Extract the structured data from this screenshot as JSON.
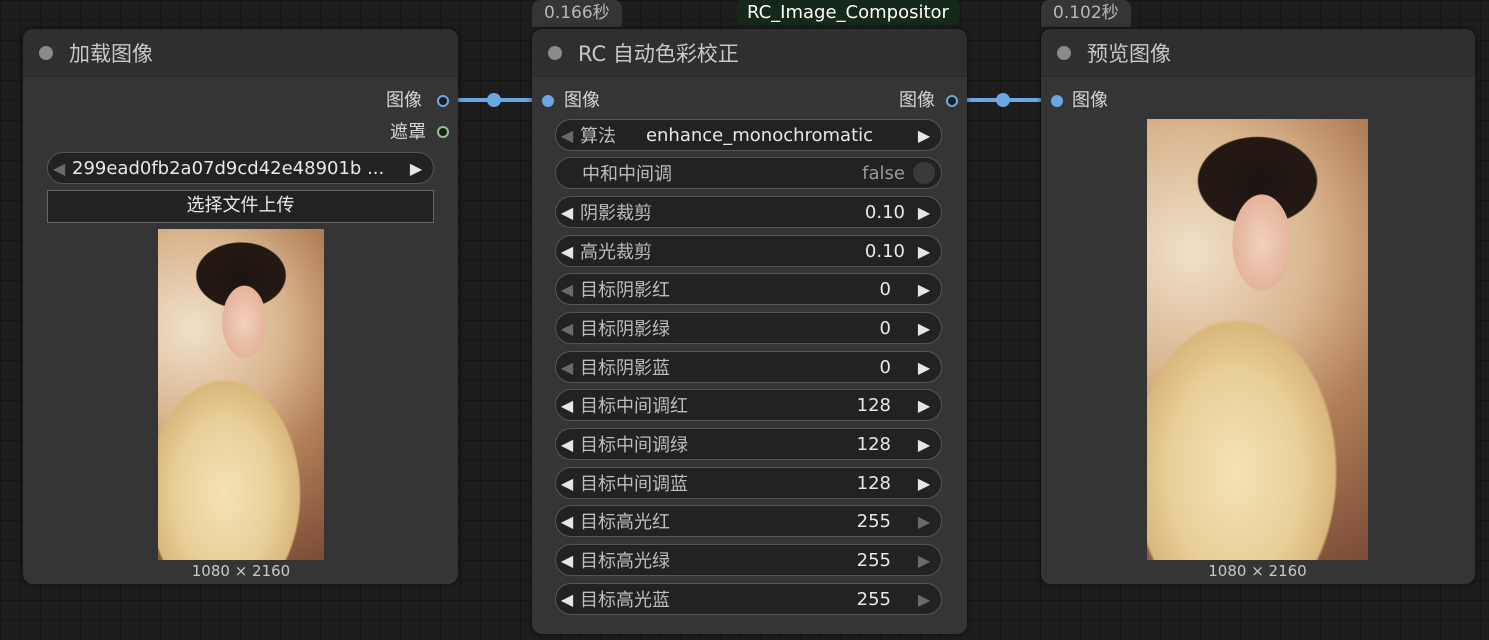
{
  "load_node": {
    "title": "加载图像",
    "output_image": "图像",
    "output_mask": "遮罩",
    "file_widget": "299ead0fb2a07d9cd42e48901b ...",
    "upload_button": "选择文件上传",
    "image_size": "1080 × 2160"
  },
  "rc_node": {
    "time_badge": "0.166秒",
    "group_title": "RC_Image_Compositor",
    "title": "RC 自动色彩校正",
    "input_image": "图像",
    "output_image": "图像",
    "widgets": [
      {
        "label": "算法",
        "value": "enhance_monochromatic"
      },
      {
        "label": "中和中间调",
        "value": "false"
      },
      {
        "label": "阴影裁剪",
        "value": "0.10"
      },
      {
        "label": "高光裁剪",
        "value": "0.10"
      },
      {
        "label": "目标阴影红",
        "value": "0"
      },
      {
        "label": "目标阴影绿",
        "value": "0"
      },
      {
        "label": "目标阴影蓝",
        "value": "0"
      },
      {
        "label": "目标中间调红",
        "value": "128"
      },
      {
        "label": "目标中间调绿",
        "value": "128"
      },
      {
        "label": "目标中间调蓝",
        "value": "128"
      },
      {
        "label": "目标高光红",
        "value": "255"
      },
      {
        "label": "目标高光绿",
        "value": "255"
      },
      {
        "label": "目标高光蓝",
        "value": "255"
      }
    ]
  },
  "preview_node": {
    "time_badge": "0.102秒",
    "title": "预览图像",
    "input_image": "图像",
    "image_size": "1080 × 2160"
  },
  "icons": {
    "left_arrow": "◀",
    "right_arrow": "▶"
  },
  "colors": {
    "image_link": "#6aa7e3",
    "mask_port": "#89c98a",
    "node_bg": "#353535",
    "canvas_bg": "#1d1d1d"
  }
}
